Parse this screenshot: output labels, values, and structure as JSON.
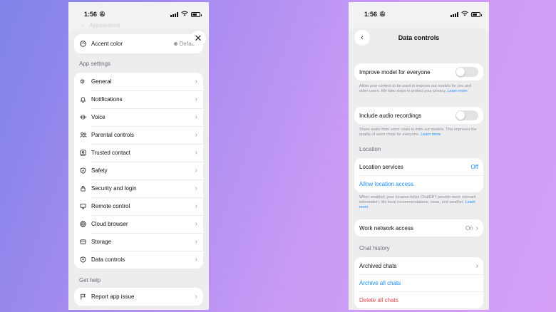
{
  "status": {
    "time": "1:56"
  },
  "left": {
    "ghost_label": "Appearance",
    "accent": {
      "label": "Accent color",
      "value": "Default"
    },
    "app_settings_title": "App settings",
    "app_settings": [
      {
        "label": "General",
        "icon": "gear-icon"
      },
      {
        "label": "Notifications",
        "icon": "bell-icon"
      },
      {
        "label": "Voice",
        "icon": "waveform-icon"
      },
      {
        "label": "Parental controls",
        "icon": "people-icon"
      },
      {
        "label": "Trusted contact",
        "icon": "contact-icon"
      },
      {
        "label": "Safety",
        "icon": "shield-icon"
      },
      {
        "label": "Security and login",
        "icon": "lock-icon"
      },
      {
        "label": "Remote control",
        "icon": "monitor-icon"
      },
      {
        "label": "Cloud browser",
        "icon": "globe-icon"
      },
      {
        "label": "Storage",
        "icon": "storage-icon"
      },
      {
        "label": "Data controls",
        "icon": "data-shield-icon"
      }
    ],
    "get_help_title": "Get help",
    "report": {
      "label": "Report app issue",
      "icon": "flag-icon"
    }
  },
  "right": {
    "title": "Data controls",
    "improve": {
      "label": "Improve model for everyone",
      "note": "Allow your content to be used to improve our models for you and other users. We take steps to protect your privacy.",
      "link": "Learn more"
    },
    "audio": {
      "label": "Include audio recordings",
      "note": "Share audio from voice chats to train our models. This improves the quality of voice chats for everyone.",
      "link": "Learn more"
    },
    "location_title": "Location",
    "location_services": {
      "label": "Location services",
      "value": "Off"
    },
    "allow_location": "Allow location access",
    "location_note": "When enabled, your location helps ChatGPT provide more relevant information, like local recommendations, news, and weather.",
    "location_link": "Learn more",
    "work_network": {
      "label": "Work network access",
      "value": "On"
    },
    "chat_history_title": "Chat history",
    "archived": "Archived chats",
    "archive_all": "Archive all chats",
    "delete_all": "Delete all chats"
  }
}
